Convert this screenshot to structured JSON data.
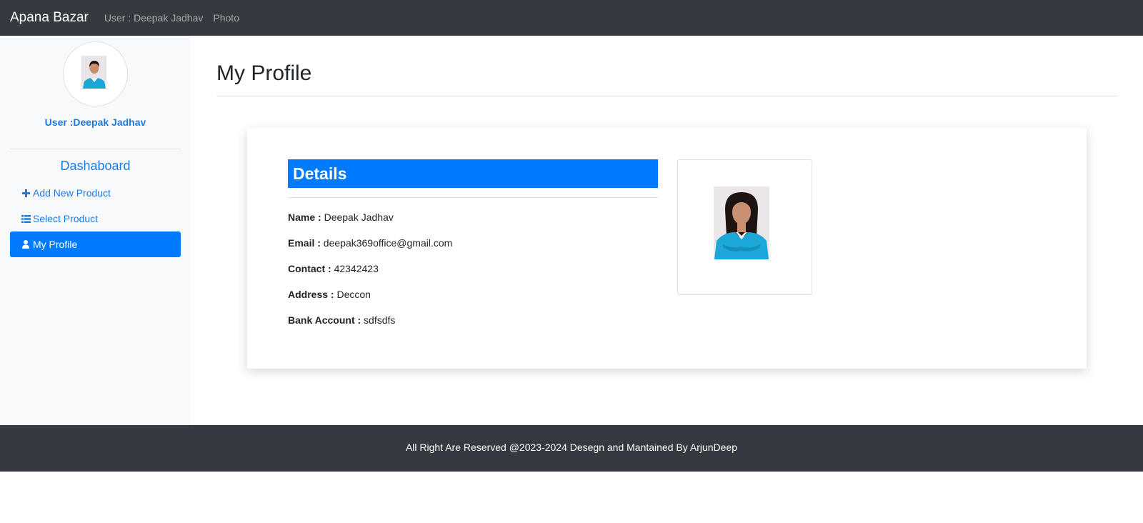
{
  "navbar": {
    "brand": "Apana Bazar",
    "user_link": "User : Deepak Jadhav",
    "photo_link": "Photo"
  },
  "sidebar": {
    "user_label": "User :Deepak Jadhav",
    "dashboard_title": "Dashaboard",
    "items": [
      {
        "label": "Add New Product",
        "icon": "plus-icon",
        "active": false
      },
      {
        "label": "Select Product",
        "icon": "list-icon",
        "active": false
      },
      {
        "label": "My Profile",
        "icon": "user-icon",
        "active": true
      }
    ]
  },
  "main": {
    "page_title": "My Profile",
    "details_title": "Details",
    "fields": [
      {
        "label": "Name :",
        "value": "Deepak Jadhav"
      },
      {
        "label": "Email :",
        "value": "deepak369office@gmail.com"
      },
      {
        "label": "Contact :",
        "value": "42342423"
      },
      {
        "label": "Address :",
        "value": "Deccon"
      },
      {
        "label": "Bank Account :",
        "value": "sdfsdfs"
      }
    ]
  },
  "footer": {
    "text": "All Right Are Reserved @2023-2024 Desegn and Mantained By ArjunDeep"
  },
  "colors": {
    "navbar_bg": "#343a40",
    "accent": "#007bff",
    "link": "#1f7ae0",
    "sidebar_bg": "#f8f9fa"
  }
}
